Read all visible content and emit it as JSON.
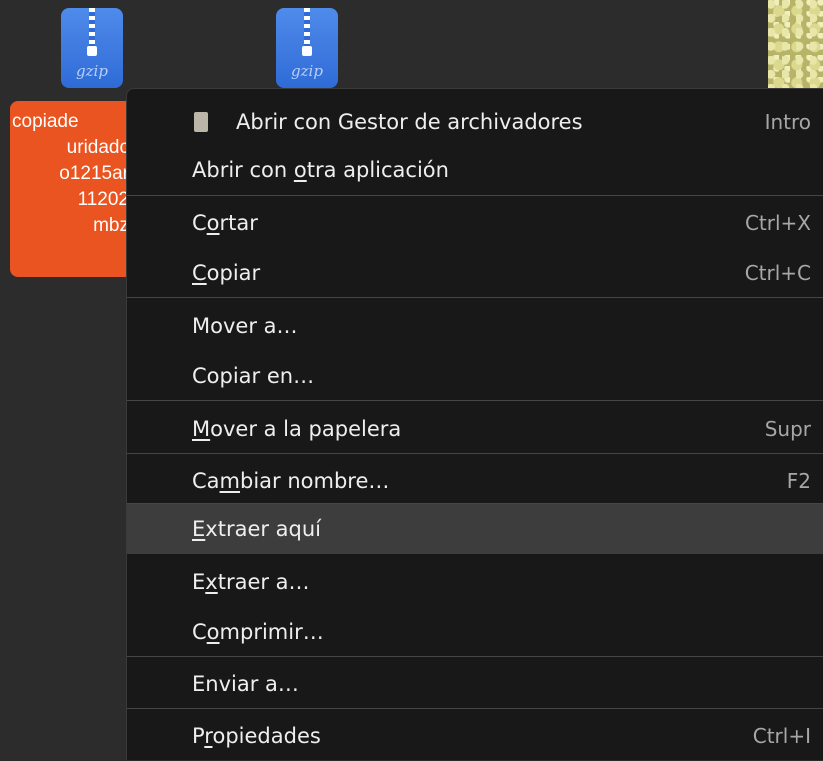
{
  "desktop": {
    "icons": [
      {
        "label": "gzip",
        "icon": "gzip-archive-icon"
      },
      {
        "label": "gzip",
        "icon": "gzip-archive-icon"
      }
    ],
    "selected_file_name_lines": [
      "copiade",
      "uridadc",
      "o1215ar",
      "11202",
      "mbz"
    ]
  },
  "context_menu": {
    "items": [
      {
        "pre": "",
        "mn": "",
        "post": "Abrir con Gestor de archivadores",
        "accel": "Intro",
        "icon": "archive-manager-icon"
      },
      {
        "pre": "Abrir con ",
        "mn": "o",
        "post": "tra aplicación",
        "accel": ""
      },
      {
        "pre": "C",
        "mn": "o",
        "post": "rtar",
        "accel": "Ctrl+X"
      },
      {
        "pre": "",
        "mn": "C",
        "post": "opiar",
        "accel": "Ctrl+C"
      },
      {
        "pre": "Mover a…",
        "mn": "",
        "post": "",
        "accel": ""
      },
      {
        "pre": "Copiar en…",
        "mn": "",
        "post": "",
        "accel": ""
      },
      {
        "pre": "",
        "mn": "M",
        "post": "over a la papelera",
        "accel": "Supr"
      },
      {
        "pre": "Ca",
        "mn": "m",
        "post": "biar nombre…",
        "accel": "F2"
      },
      {
        "pre": "",
        "mn": "E",
        "post": "xtraer aquí",
        "accel": ""
      },
      {
        "pre": "E",
        "mn": "x",
        "post": "traer a…",
        "accel": ""
      },
      {
        "pre": "C",
        "mn": "o",
        "post": "mprimir…",
        "accel": ""
      },
      {
        "pre": "Enviar a…",
        "mn": "",
        "post": "",
        "accel": ""
      },
      {
        "pre": "P",
        "mn": "r",
        "post": "opiedades",
        "accel": "Ctrl+I"
      }
    ]
  },
  "colors": {
    "selection_orange": "#e95420",
    "menu_background": "#181818",
    "menu_highlight": "#3d3d3d"
  }
}
